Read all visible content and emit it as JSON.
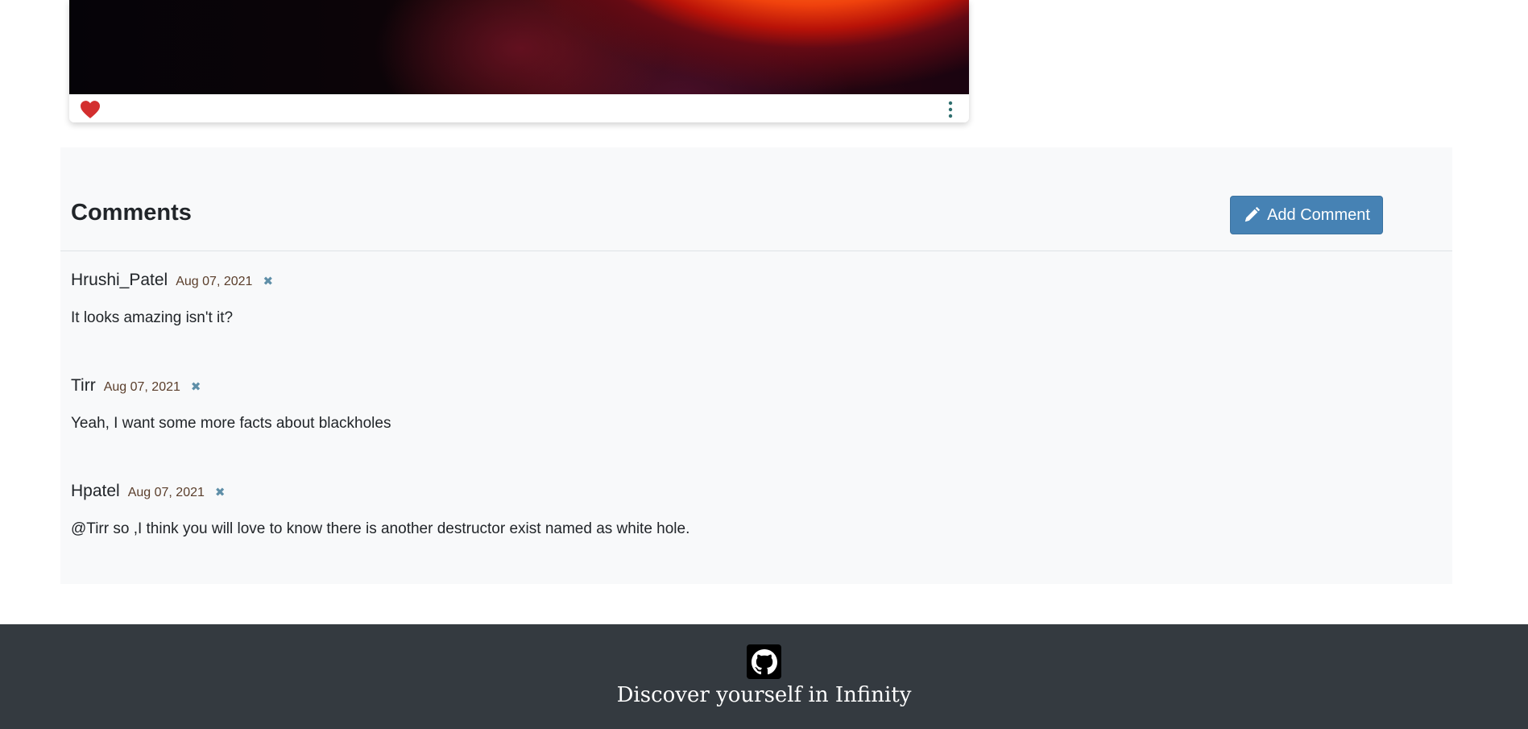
{
  "post": {
    "like_icon": "heart-icon",
    "like_color": "#dc3545",
    "options_icon": "kebab-icon"
  },
  "comments_section": {
    "title": "Comments",
    "add_button_label": "Add Comment",
    "add_button_icon": "pencil-icon",
    "accent_color": "#4682b4",
    "items": [
      {
        "author": "Hrushi_Patel",
        "date": "Aug 07, 2021",
        "delete_icon": "✖",
        "text": "It looks amazing isn't it?"
      },
      {
        "author": "Tirr",
        "date": "Aug 07, 2021",
        "delete_icon": "✖",
        "text": "Yeah, I want some more facts about blackholes"
      },
      {
        "author": "Hpatel",
        "date": "Aug 07, 2021",
        "delete_icon": "✖",
        "text": "@Tirr so ,I think you will love to know there is another destructor exist named as white hole."
      }
    ]
  },
  "footer": {
    "icon": "github-icon",
    "tagline": "Discover yourself in Infinity",
    "background": "#343a40"
  }
}
